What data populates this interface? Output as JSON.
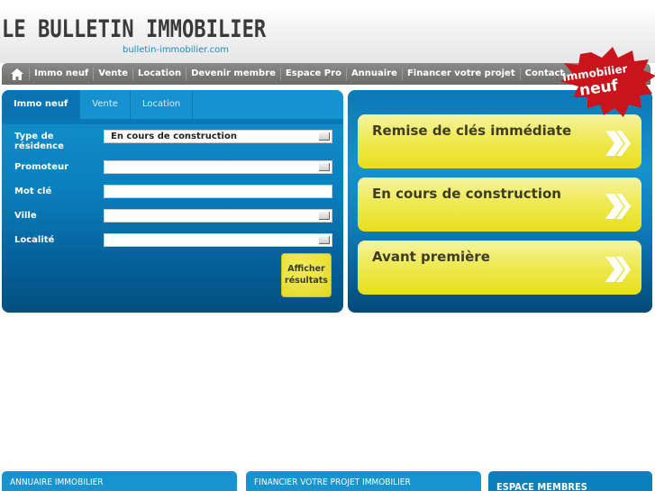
{
  "header": {
    "logo_text": "LE BULLETIN IMMOBILIER",
    "logo_subtitle": "bulletin-immobilier.com"
  },
  "nav": {
    "home_icon": "home-icon",
    "items": [
      {
        "label": "Immo neuf"
      },
      {
        "label": "Vente"
      },
      {
        "label": "Location"
      },
      {
        "label": "Devenir membre"
      },
      {
        "label": "Espace Pro"
      },
      {
        "label": "Annuaire"
      },
      {
        "label": "Financer votre projet"
      },
      {
        "label": "Contact"
      }
    ]
  },
  "badge": {
    "line1": "Immobilier",
    "line2": "neuf",
    "color": "#c8141a"
  },
  "search": {
    "tabs": [
      {
        "label": "Immo neuf",
        "active": true
      },
      {
        "label": "Vente",
        "active": false
      },
      {
        "label": "Location",
        "active": false
      }
    ],
    "fields": {
      "type_residence": {
        "label": "Type de résidence",
        "value": "En cours de construction"
      },
      "promoteur": {
        "label": "Promoteur",
        "value": ""
      },
      "mot_cle": {
        "label": "Mot clé",
        "value": ""
      },
      "ville": {
        "label": "Ville",
        "value": ""
      },
      "localite": {
        "label": "Localité",
        "value": ""
      }
    },
    "submit_line1": "Afficher",
    "submit_line2": "résultats"
  },
  "quick_links": [
    {
      "label": "Remise de clés immédiate"
    },
    {
      "label": "En cours de construction"
    },
    {
      "label": "Avant première"
    }
  ],
  "bottom": {
    "annuaire": "ANNUAIRE IMMOBILIER",
    "financer": "FINANCIER VOTRE PROJET IMMOBILIER",
    "espace": "ESPACE MEMBRES"
  },
  "colors": {
    "brand_blue": "#1592cf",
    "accent_yellow": "#efea55",
    "nav_gray": "#6c6c6a"
  }
}
